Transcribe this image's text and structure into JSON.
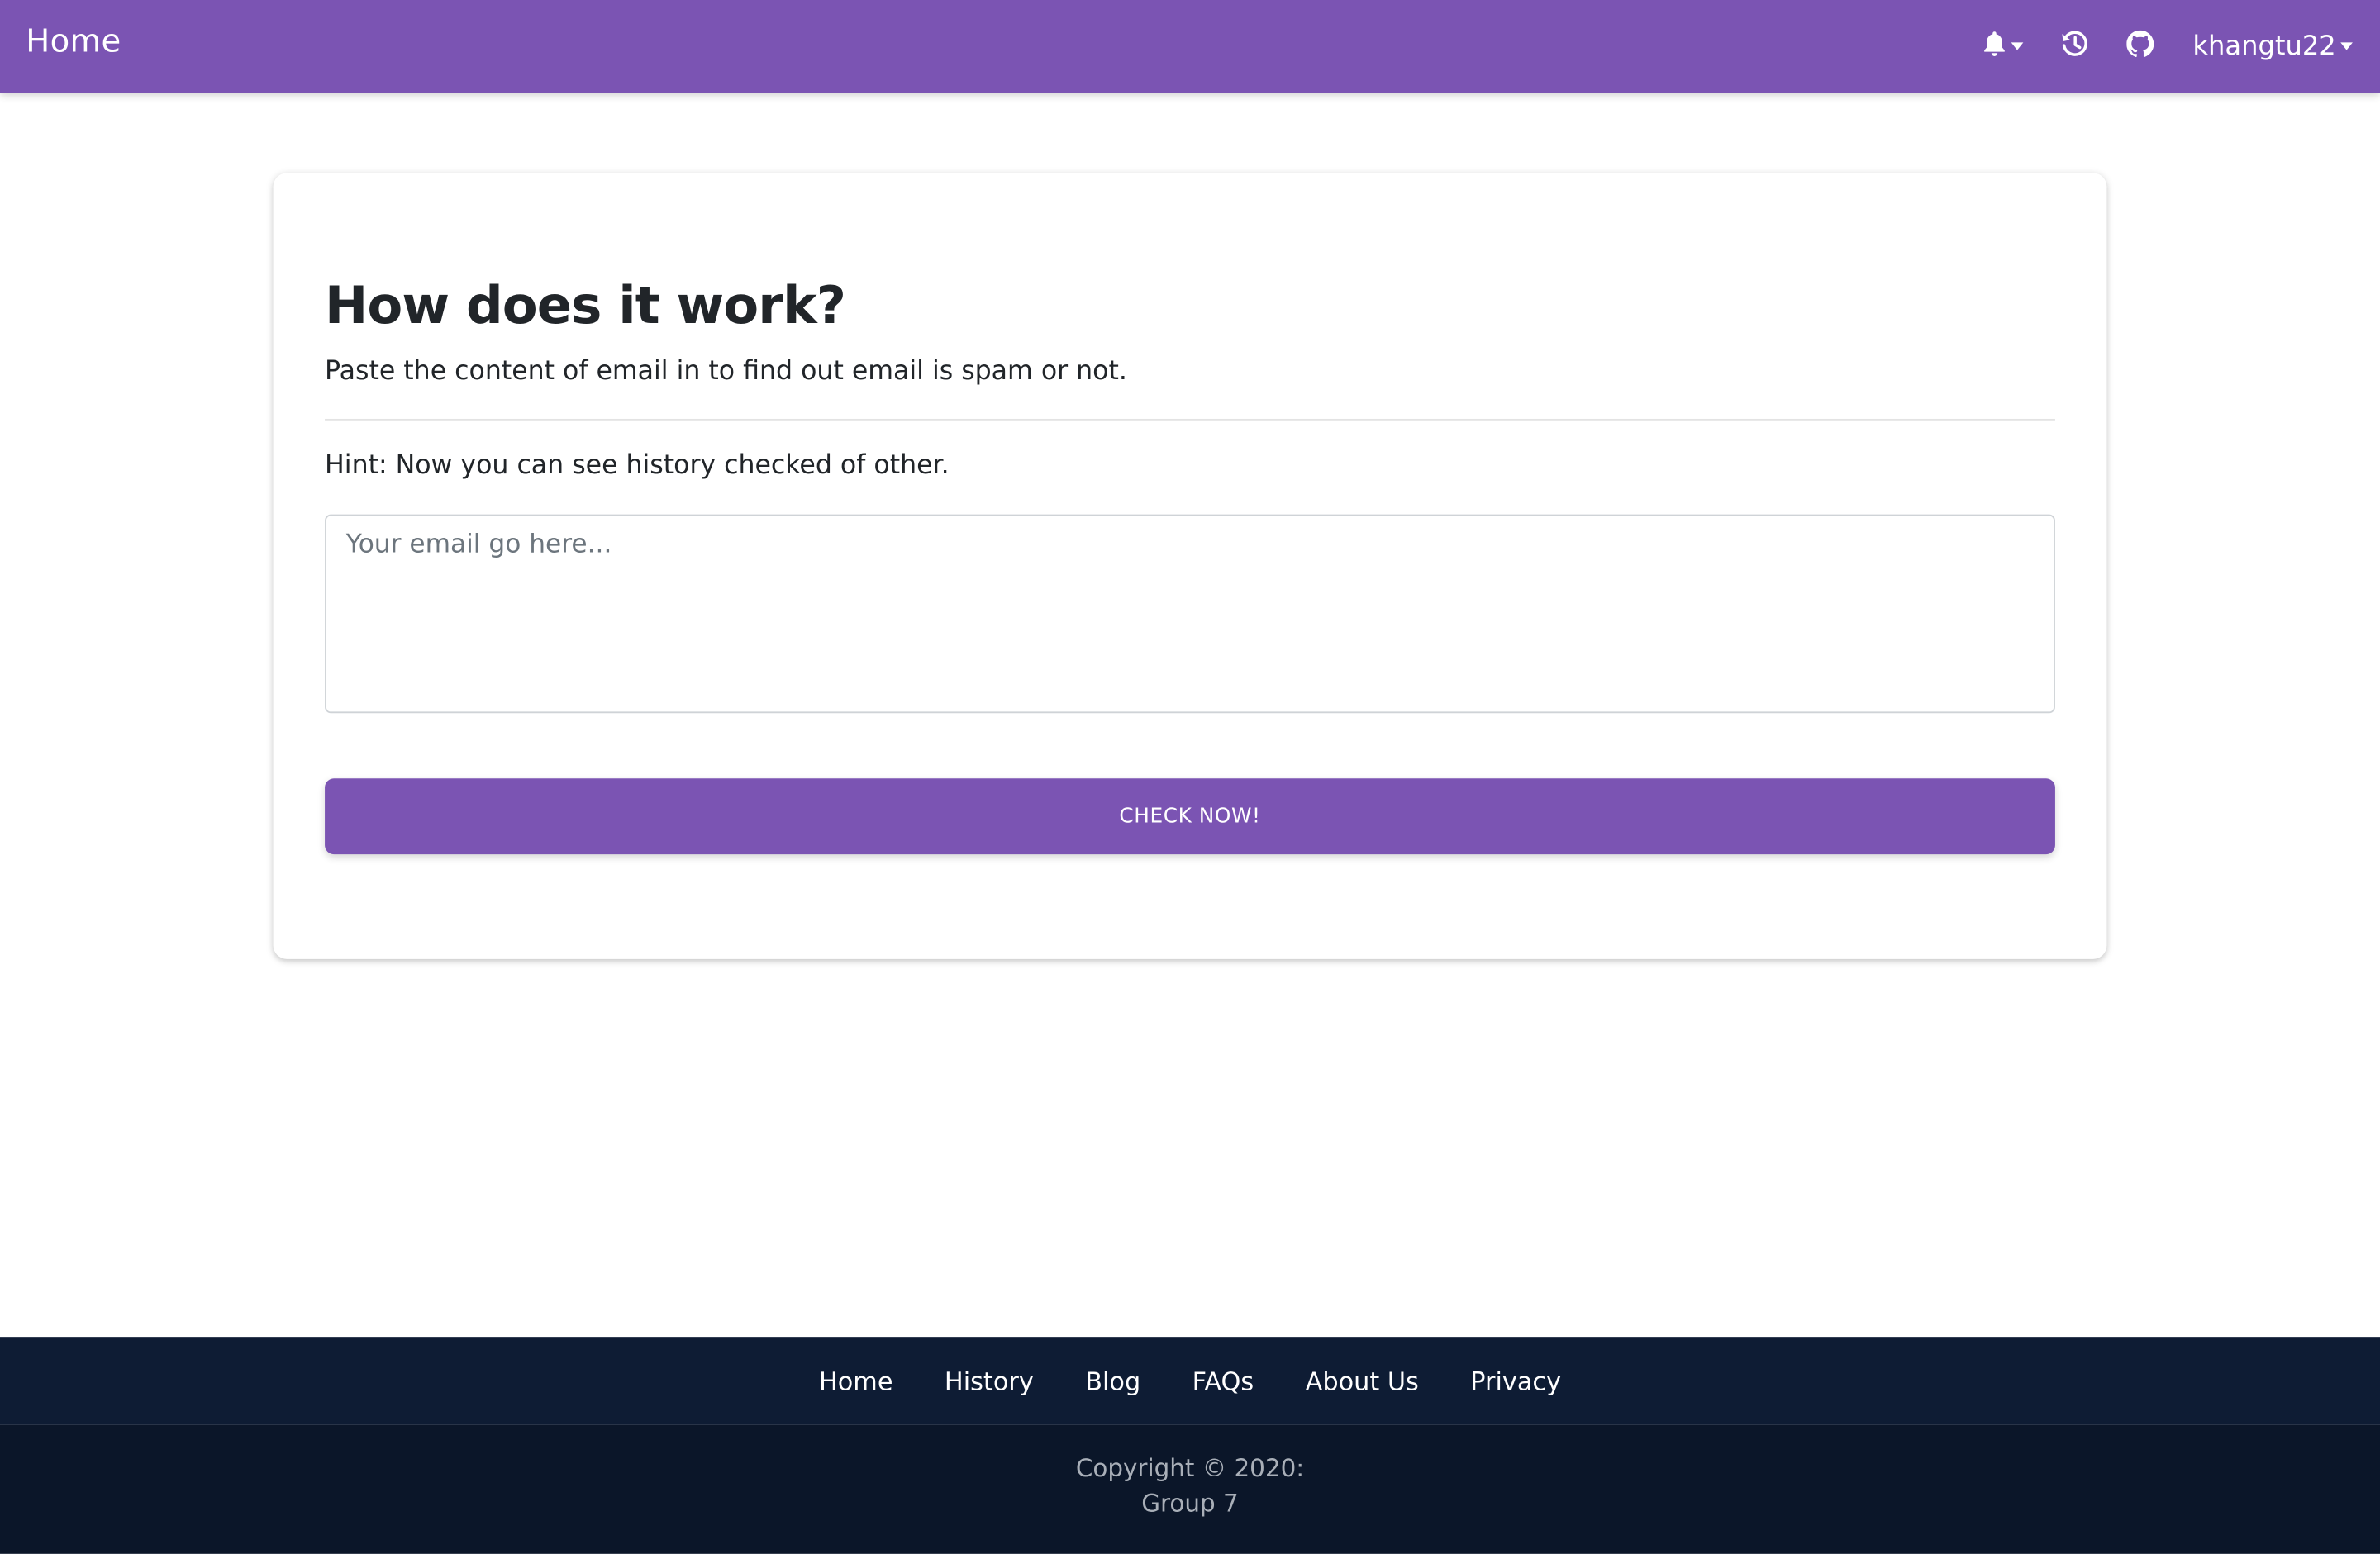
{
  "navbar": {
    "brand": "Home",
    "username": "khangtu22",
    "bg_color": "#7b54b3",
    "icons": [
      "bell-icon",
      "history-icon",
      "github-icon"
    ]
  },
  "main": {
    "title": "How does it work?",
    "subtitle": "Paste the content of email in to find out email is spam or not.",
    "hint": "Hint: Now you can see history checked of other.",
    "email_placeholder": "Your email go here...",
    "email_value": "",
    "check_button": "CHECK NOW!"
  },
  "footer": {
    "links": [
      "Home",
      "History",
      "Blog",
      "FAQs",
      "About Us",
      "Privacy"
    ],
    "copyright_line1": "Copyright © 2020:",
    "copyright_line2": "Group 7",
    "links_bg": "#0e1c34",
    "copy_bg": "#0b1629"
  }
}
